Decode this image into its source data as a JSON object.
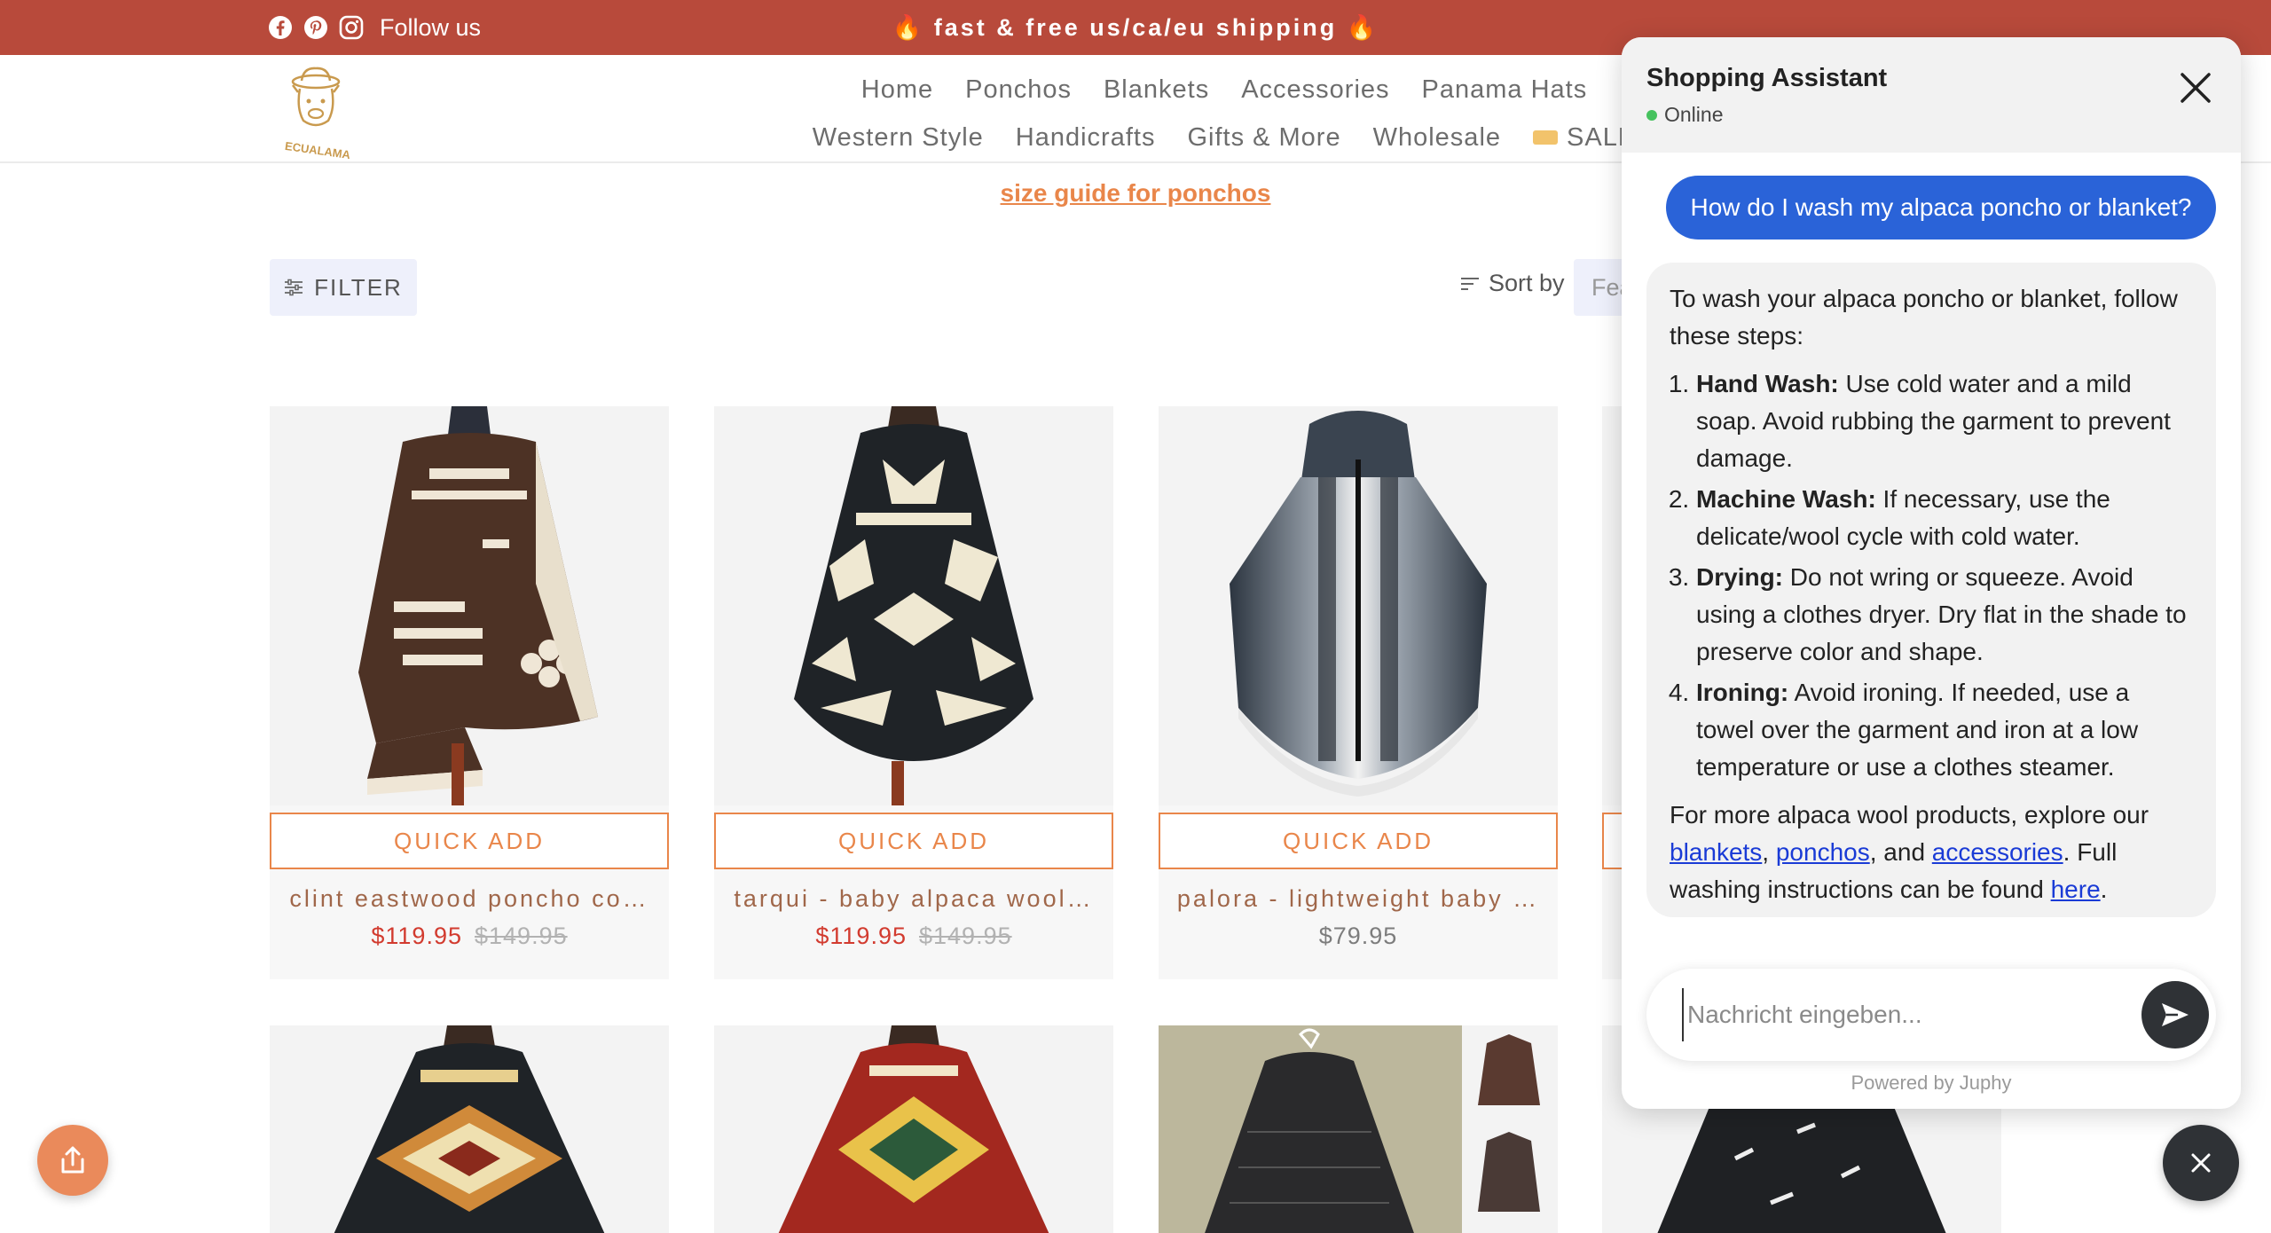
{
  "topbar": {
    "follow_label": "Follow us",
    "announcement": "🔥 fast & free us/ca/eu shipping 🔥",
    "social_icons": [
      "facebook-icon",
      "pinterest-icon",
      "instagram-icon"
    ],
    "bg_color": "#b84a3b"
  },
  "header": {
    "logo_text": "ECUALAMA",
    "nav_row1": [
      "Home",
      "Ponchos",
      "Blankets",
      "Accessories",
      "Panama Hats"
    ],
    "nav_row2": [
      "Western Style",
      "Handicrafts",
      "Gifts & More",
      "Wholesale",
      "SALE"
    ]
  },
  "collection": {
    "size_guide": "size guide for ponchos",
    "filter_label": "FILTER",
    "sort_label": "Sort by",
    "sort_value": "Featured",
    "quick_add_label": "QUICK ADD"
  },
  "products": [
    {
      "title": "clint eastwood poncho co…",
      "price": "$119.95",
      "compare_price": "$149.95"
    },
    {
      "title": "tarqui - baby alpaca wool…",
      "price": "$119.95",
      "compare_price": "$149.95"
    },
    {
      "title": "palora - lightweight baby …",
      "price": "$79.95"
    }
  ],
  "chat": {
    "title": "Shopping Assistant",
    "status": "Online",
    "user_message": "How do I wash my alpaca poncho or blanket?",
    "bot_intro": "To wash your alpaca poncho or blanket, follow these steps:",
    "steps": [
      {
        "label": "Hand Wash:",
        "text": " Use cold water and a mild soap. Avoid rubbing the garment to prevent damage."
      },
      {
        "label": "Machine Wash:",
        "text": " If necessary, use the delicate/wool cycle with cold water."
      },
      {
        "label": "Drying:",
        "text": " Do not wring or squeeze. Avoid using a clothes dryer. Dry flat in the shade to preserve color and shape."
      },
      {
        "label": "Ironing:",
        "text": " Avoid ironing. If needed, use a towel over the garment and iron at a low temperature or use a clothes steamer."
      }
    ],
    "outro_1": "For more alpaca wool products, explore our ",
    "link_blankets": "blankets",
    "sep_1": ", ",
    "link_ponchos": "ponchos",
    "sep_2": ", and ",
    "link_accessories": "accessories",
    "outro_2": ". Full washing instructions can be found ",
    "link_here": "here",
    "outro_3": ".",
    "input_placeholder": "Nachricht eingeben...",
    "powered_by": "Powered by Juphy",
    "accent_color": "#2a63d8"
  },
  "colors": {
    "accent_orange": "#e9864a",
    "sale_red": "#d23b2f"
  }
}
